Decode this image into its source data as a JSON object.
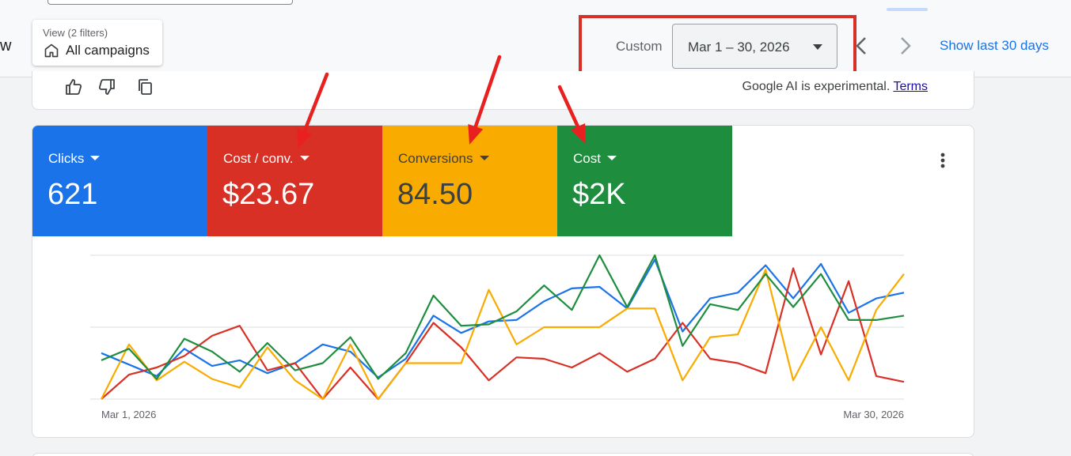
{
  "header": {
    "title_fragment": "w",
    "view_chip": {
      "label": "View (2 filters)",
      "value": "All campaigns",
      "icon": "home-icon"
    },
    "date_range": {
      "preset_label": "Custom",
      "value": "Mar 1 – 30, 2026"
    },
    "nav_icons": [
      "chevron-left-icon",
      "chevron-right-icon"
    ],
    "show_last_link": "Show last 30 days"
  },
  "ai_feedback": {
    "icons": [
      "thumb-up-icon",
      "thumb-down-icon",
      "copy-icon"
    ],
    "note": "Google AI is experimental.",
    "terms_link": "Terms"
  },
  "metrics": [
    {
      "label": "Clicks",
      "value": "621",
      "color": "#1a73e8",
      "text_color": "#ffffff"
    },
    {
      "label": "Cost / conv.",
      "value": "$23.67",
      "color": "#d93025",
      "text_color": "#ffffff"
    },
    {
      "label": "Conversions",
      "value": "84.50",
      "color": "#f9ab00",
      "text_color": "#3c4043"
    },
    {
      "label": "Cost",
      "value": "$2K",
      "color": "#1e8e3e",
      "text_color": "#ffffff"
    }
  ],
  "annotation_color": "#e8201f",
  "chart_data": {
    "type": "line",
    "x_start_label": "Mar 1, 2026",
    "x_end_label": "Mar 30, 2026",
    "ylim": [
      0,
      100
    ],
    "grid": true,
    "series": [
      {
        "color": "#1a73e8",
        "values": [
          32,
          24,
          16,
          35,
          23,
          27,
          18,
          25,
          38,
          33,
          15,
          28,
          58,
          46,
          54,
          55,
          68,
          77,
          78,
          63,
          97,
          47,
          70,
          74,
          93,
          70,
          94,
          60,
          70,
          74
        ]
      },
      {
        "color": "#d93025",
        "values": [
          0,
          17,
          22,
          30,
          44,
          51,
          20,
          25,
          0,
          22,
          0,
          25,
          53,
          36,
          13,
          29,
          28,
          22,
          32,
          19,
          28,
          53,
          28,
          25,
          18,
          91,
          31,
          82,
          16,
          12
        ]
      },
      {
        "color": "#f9ab00",
        "values": [
          0,
          38,
          13,
          26,
          14,
          8,
          36,
          13,
          0,
          38,
          0,
          25,
          25,
          25,
          76,
          38,
          50,
          50,
          50,
          63,
          63,
          13,
          43,
          45,
          90,
          13,
          50,
          13,
          62,
          87
        ]
      },
      {
        "color": "#1e8e3e",
        "values": [
          27,
          35,
          14,
          42,
          33,
          19,
          39,
          20,
          25,
          43,
          14,
          32,
          72,
          51,
          52,
          61,
          79,
          62,
          100,
          64,
          100,
          37,
          66,
          62,
          87,
          64,
          87,
          55,
          55,
          58
        ]
      }
    ]
  }
}
